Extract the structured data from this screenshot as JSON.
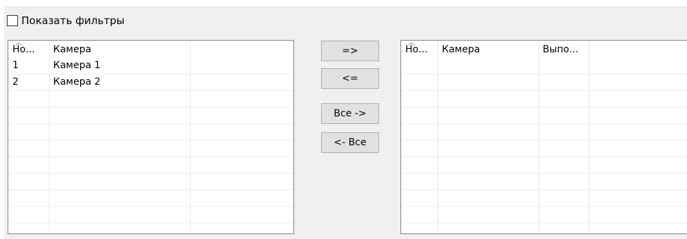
{
  "filters": {
    "show_filters_label": "Показать фильтры",
    "checked": false
  },
  "left_list": {
    "columns": [
      "Но...",
      "Камера",
      ""
    ],
    "rows": [
      {
        "num": "1",
        "camera": "Камера 1"
      },
      {
        "num": "2",
        "camera": "Камера 2"
      }
    ]
  },
  "buttons": {
    "move_right": "=>",
    "move_left": "<=",
    "move_all_right": "Все ->",
    "move_all_left": "<- Все"
  },
  "right_list": {
    "columns": [
      "Но...",
      "Камера",
      "Выпо...",
      ""
    ],
    "rows": []
  }
}
